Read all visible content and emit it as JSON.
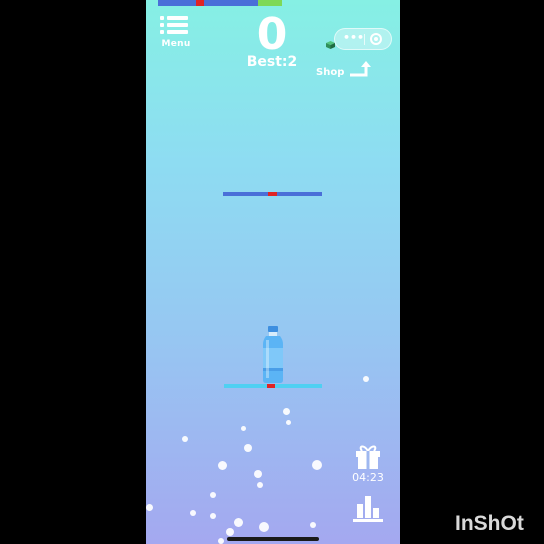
{
  "game": {
    "menu_label": "Menu",
    "score": "0",
    "best": "Best:2",
    "shop_label": "Shop",
    "gift_timer": "04:23",
    "capsule_dots": "•••"
  },
  "progress_bar": [
    {
      "color": "#4a6fd8"
    },
    {
      "color": "#e02424"
    },
    {
      "color": "#4a6fd8"
    },
    {
      "color": "#7ed957"
    }
  ],
  "colors": {
    "platform_top": "#4a6fd8",
    "platform_bottom": "#4fd0f2",
    "marker": "#e02424",
    "bottle_body": "#5bb4f5",
    "bottle_cap": "#3e8fe0",
    "cube": "#2f8f5a"
  },
  "icons": {
    "menu": "list-icon",
    "capsule_more": "more-dots-icon",
    "capsule_close": "target-icon",
    "shop": "shop-arrow-icon",
    "gift": "gift-icon",
    "rank": "bar-chart-icon"
  },
  "watermark": "InShOt"
}
